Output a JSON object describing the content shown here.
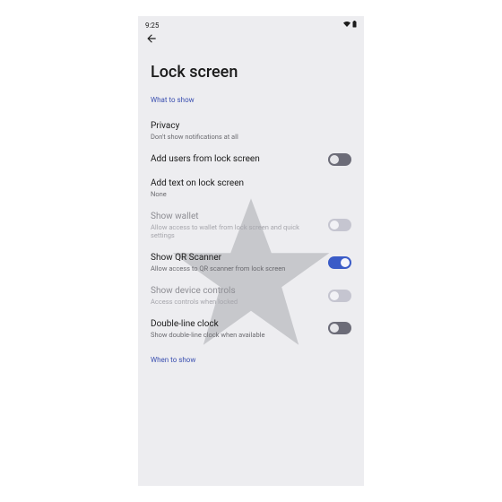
{
  "status": {
    "time": "9:25"
  },
  "page": {
    "title": "Lock screen"
  },
  "sections": {
    "what_to_show": "What to show",
    "when_to_show": "When to show"
  },
  "items": {
    "privacy": {
      "title": "Privacy",
      "sub": "Don't show notifications at all"
    },
    "add_users": {
      "title": "Add users from lock screen"
    },
    "add_text": {
      "title": "Add text on lock screen",
      "sub": "None"
    },
    "wallet": {
      "title": "Show wallet",
      "sub": "Allow access to wallet from lock screen and quick settings"
    },
    "qr": {
      "title": "Show QR Scanner",
      "sub": "Allow access to QR scanner from lock screen"
    },
    "device_controls": {
      "title": "Show device controls",
      "sub": "Access controls when locked"
    },
    "clock": {
      "title": "Double-line clock",
      "sub": "Show double-line clock when available"
    }
  }
}
